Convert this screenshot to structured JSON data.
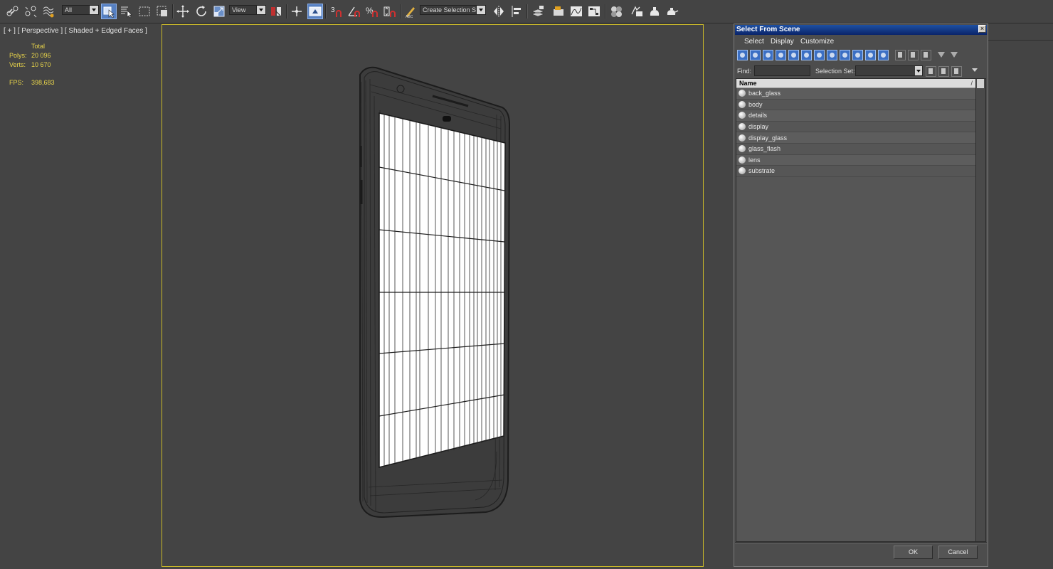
{
  "toolbar": {
    "selection_filter": "All",
    "reference_coordinate": "View",
    "snap_label": "3",
    "named_selection_set": "Create Selection Se",
    "icons": [
      "link-icon",
      "unlink-icon",
      "bind-spacewarp-icon",
      "select-object-icon",
      "select-by-name-icon",
      "rect-region-icon",
      "window-crossing-icon",
      "move-icon",
      "rotate-icon",
      "scale-icon",
      "select-manipulate-icon",
      "pivot-center-icon",
      "keyboard-shortcut-icon",
      "snaps-toggle-icon",
      "angle-snap-icon",
      "percent-snap-icon",
      "spinner-snap-icon",
      "edit-named-sets-icon",
      "mirror-icon",
      "align-icon",
      "layer-manager-icon",
      "graphite-ribbon-icon",
      "curve-editor-icon",
      "schematic-view-icon",
      "material-editor-icon",
      "render-setup-icon",
      "rendered-frame-icon",
      "render-production-icon"
    ]
  },
  "viewport": {
    "label": "[ + ] [ Perspective ] [ Shaded + Edged Faces ]",
    "stats": {
      "total_label": "Total",
      "polys_label": "Polys:",
      "polys_value": "20 096",
      "verts_label": "Verts:",
      "verts_value": "10 670",
      "fps_label": "FPS:",
      "fps_value": "398,683"
    },
    "colors": {
      "background": "#444444",
      "active_border": "#c9b82a",
      "stats_text": "#e8d44a",
      "wire": "#1e1e1e",
      "screen": "#ffffff"
    }
  },
  "dialog": {
    "title": "Select From Scene",
    "close": "×",
    "menu": [
      "Select",
      "Display",
      "Customize"
    ],
    "find_label": "Find:",
    "find_value": "",
    "selection_set_label": "Selection Set:",
    "selection_set_value": "",
    "column_header": "Name",
    "sort_indicator": "/",
    "items": [
      "back_glass",
      "body",
      "details",
      "display",
      "display_glass",
      "glass_flash",
      "lens",
      "substrate"
    ],
    "ok": "OK",
    "cancel": "Cancel"
  }
}
